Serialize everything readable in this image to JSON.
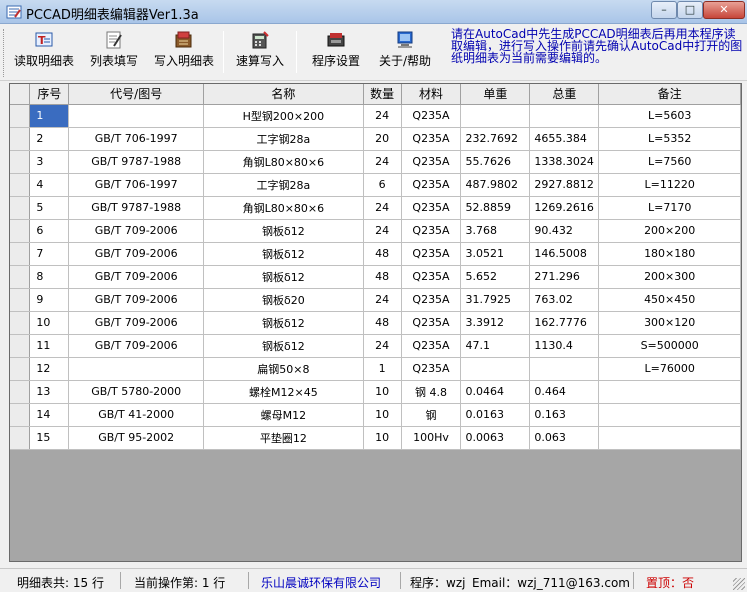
{
  "window": {
    "title": "PCCAD明细表编辑器Ver1.3a",
    "min_glyph": "–",
    "max_glyph": "□",
    "close_glyph": "✕"
  },
  "toolbar": {
    "buttons": [
      {
        "label": "读取明细表",
        "icon": "read-table-icon"
      },
      {
        "label": "列表填写",
        "icon": "fill-list-icon"
      },
      {
        "label": "写入明细表",
        "icon": "write-table-icon"
      },
      {
        "label": "速算写入",
        "icon": "quick-calc-icon"
      },
      {
        "label": "程序设置",
        "icon": "settings-icon"
      },
      {
        "label": "关于/帮助",
        "icon": "help-icon"
      }
    ],
    "hint": "请在AutoCad中先生成PCCAD明细表后再用本程序读取编辑，进行写入操作前请先确认AutoCad中打开的图纸明细表为当前需要编辑的。"
  },
  "table": {
    "headers": [
      "序号",
      "代号/图号",
      "名称",
      "数量",
      "材料",
      "单重",
      "总重",
      "备注"
    ],
    "rows": [
      [
        "1",
        "",
        "H型钢200×200",
        "24",
        "Q235A",
        "",
        "",
        "L=5603"
      ],
      [
        "2",
        "GB/T 706-1997",
        "工字钢28a",
        "20",
        "Q235A",
        "232.7692",
        "4655.384",
        "L=5352"
      ],
      [
        "3",
        "GB/T 9787-1988",
        "角钢L80×80×6",
        "24",
        "Q235A",
        "55.7626",
        "1338.3024",
        "L=7560"
      ],
      [
        "4",
        "GB/T 706-1997",
        "工字钢28a",
        "6",
        "Q235A",
        "487.9802",
        "2927.8812",
        "L=11220"
      ],
      [
        "5",
        "GB/T 9787-1988",
        "角钢L80×80×6",
        "24",
        "Q235A",
        "52.8859",
        "1269.2616",
        "L=7170"
      ],
      [
        "6",
        "GB/T 709-2006",
        "钢板δ12",
        "24",
        "Q235A",
        "3.768",
        "90.432",
        "200×200"
      ],
      [
        "7",
        "GB/T 709-2006",
        "钢板δ12",
        "48",
        "Q235A",
        "3.0521",
        "146.5008",
        "180×180"
      ],
      [
        "8",
        "GB/T 709-2006",
        "钢板δ12",
        "48",
        "Q235A",
        "5.652",
        "271.296",
        "200×300"
      ],
      [
        "9",
        "GB/T 709-2006",
        "钢板δ20",
        "24",
        "Q235A",
        "31.7925",
        "763.02",
        "450×450"
      ],
      [
        "10",
        "GB/T 709-2006",
        "钢板δ12",
        "48",
        "Q235A",
        "3.3912",
        "162.7776",
        "300×120"
      ],
      [
        "11",
        "GB/T 709-2006",
        "钢板δ12",
        "24",
        "Q235A",
        "47.1",
        "1130.4",
        "S=500000"
      ],
      [
        "12",
        "",
        "扁钢50×8",
        "1",
        "Q235A",
        "",
        "",
        "L=76000"
      ],
      [
        "13",
        "GB/T 5780-2000",
        "螺栓M12×45",
        "10",
        "钢 4.8",
        "0.0464",
        "0.464",
        ""
      ],
      [
        "14",
        "GB/T 41-2000",
        "螺母M12",
        "10",
        "钢",
        "0.0163",
        "0.163",
        ""
      ],
      [
        "15",
        "GB/T 95-2002",
        "平垫圈12",
        "10",
        "100Hv",
        "0.0063",
        "0.063",
        ""
      ]
    ]
  },
  "status": {
    "total": "明细表共: 15 行",
    "current": "当前操作第: 1 行",
    "company": "乐山晨诚环保有限公司",
    "program": "程序：wzj",
    "email": "Email：wzj_711@163.com",
    "pin": "置顶：否"
  },
  "colors": {
    "selection": "#3a6cc0",
    "hint_text": "#0000b0",
    "company_text": "#0000c0",
    "pin_text": "#cc0000"
  }
}
